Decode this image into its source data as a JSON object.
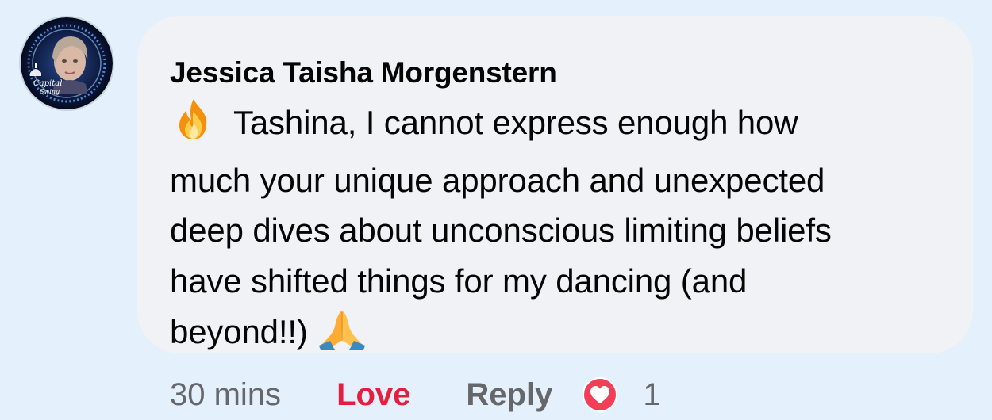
{
  "comment": {
    "author": "Jessica Taisha Morgenstern",
    "lines": [
      "Tashina, I cannot express enough how",
      "much your unique approach and unexpected",
      "deep dives about unconscious limiting beliefs",
      "have shifted things for my dancing (and",
      "beyond!!)"
    ],
    "leading_emoji": "fire-emoji",
    "trailing_emoji": "folded-hands-emoji",
    "avatar_text": "Capital Swing"
  },
  "actions": {
    "time": "30 mins",
    "love_label": "Love",
    "reply_label": "Reply",
    "reaction_icon": "heart-reaction-icon",
    "reaction_count": "1"
  },
  "colors": {
    "page_background": "#e4f0fb",
    "bubble_background": "#f0f2f5",
    "love_red": "#e41e3f",
    "secondary_text": "#65676b"
  }
}
